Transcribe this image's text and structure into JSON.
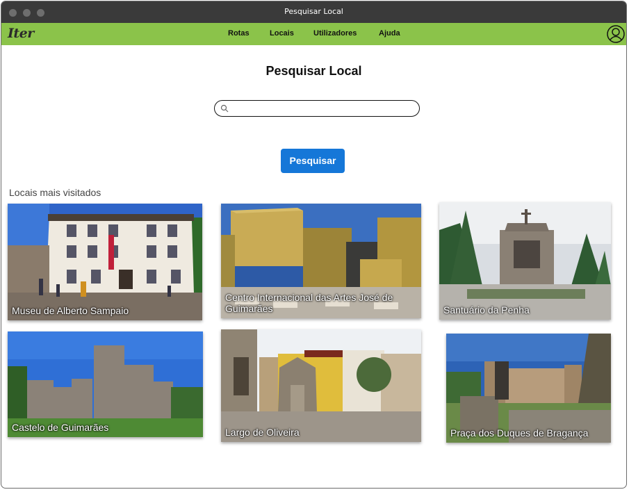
{
  "window": {
    "title": "Pesquisar Local"
  },
  "nav": {
    "logo": "Iter",
    "items": [
      "Rotas",
      "Locais",
      "Utilizadores",
      "Ajuda"
    ]
  },
  "page": {
    "heading": "Pesquisar Local",
    "search": {
      "value": "",
      "placeholder": ""
    },
    "search_button": "Pesquisar",
    "section_title": "Locais mais visitados"
  },
  "places": [
    {
      "name": "Museu de Alberto Sampaio"
    },
    {
      "name": "Centro Internacional das Artes José de Guimarães"
    },
    {
      "name": "Santuário da Penha"
    },
    {
      "name": "Castelo de Guimarães"
    },
    {
      "name": "Largo de Oliveira"
    },
    {
      "name": "Praça dos Duques de Bragança"
    }
  ],
  "icons": {
    "user": "user-profile-icon",
    "search": "search-icon"
  },
  "colors": {
    "navbar": "#8bc34a",
    "titlebar": "#3a3a3a",
    "button": "#1577d8"
  }
}
